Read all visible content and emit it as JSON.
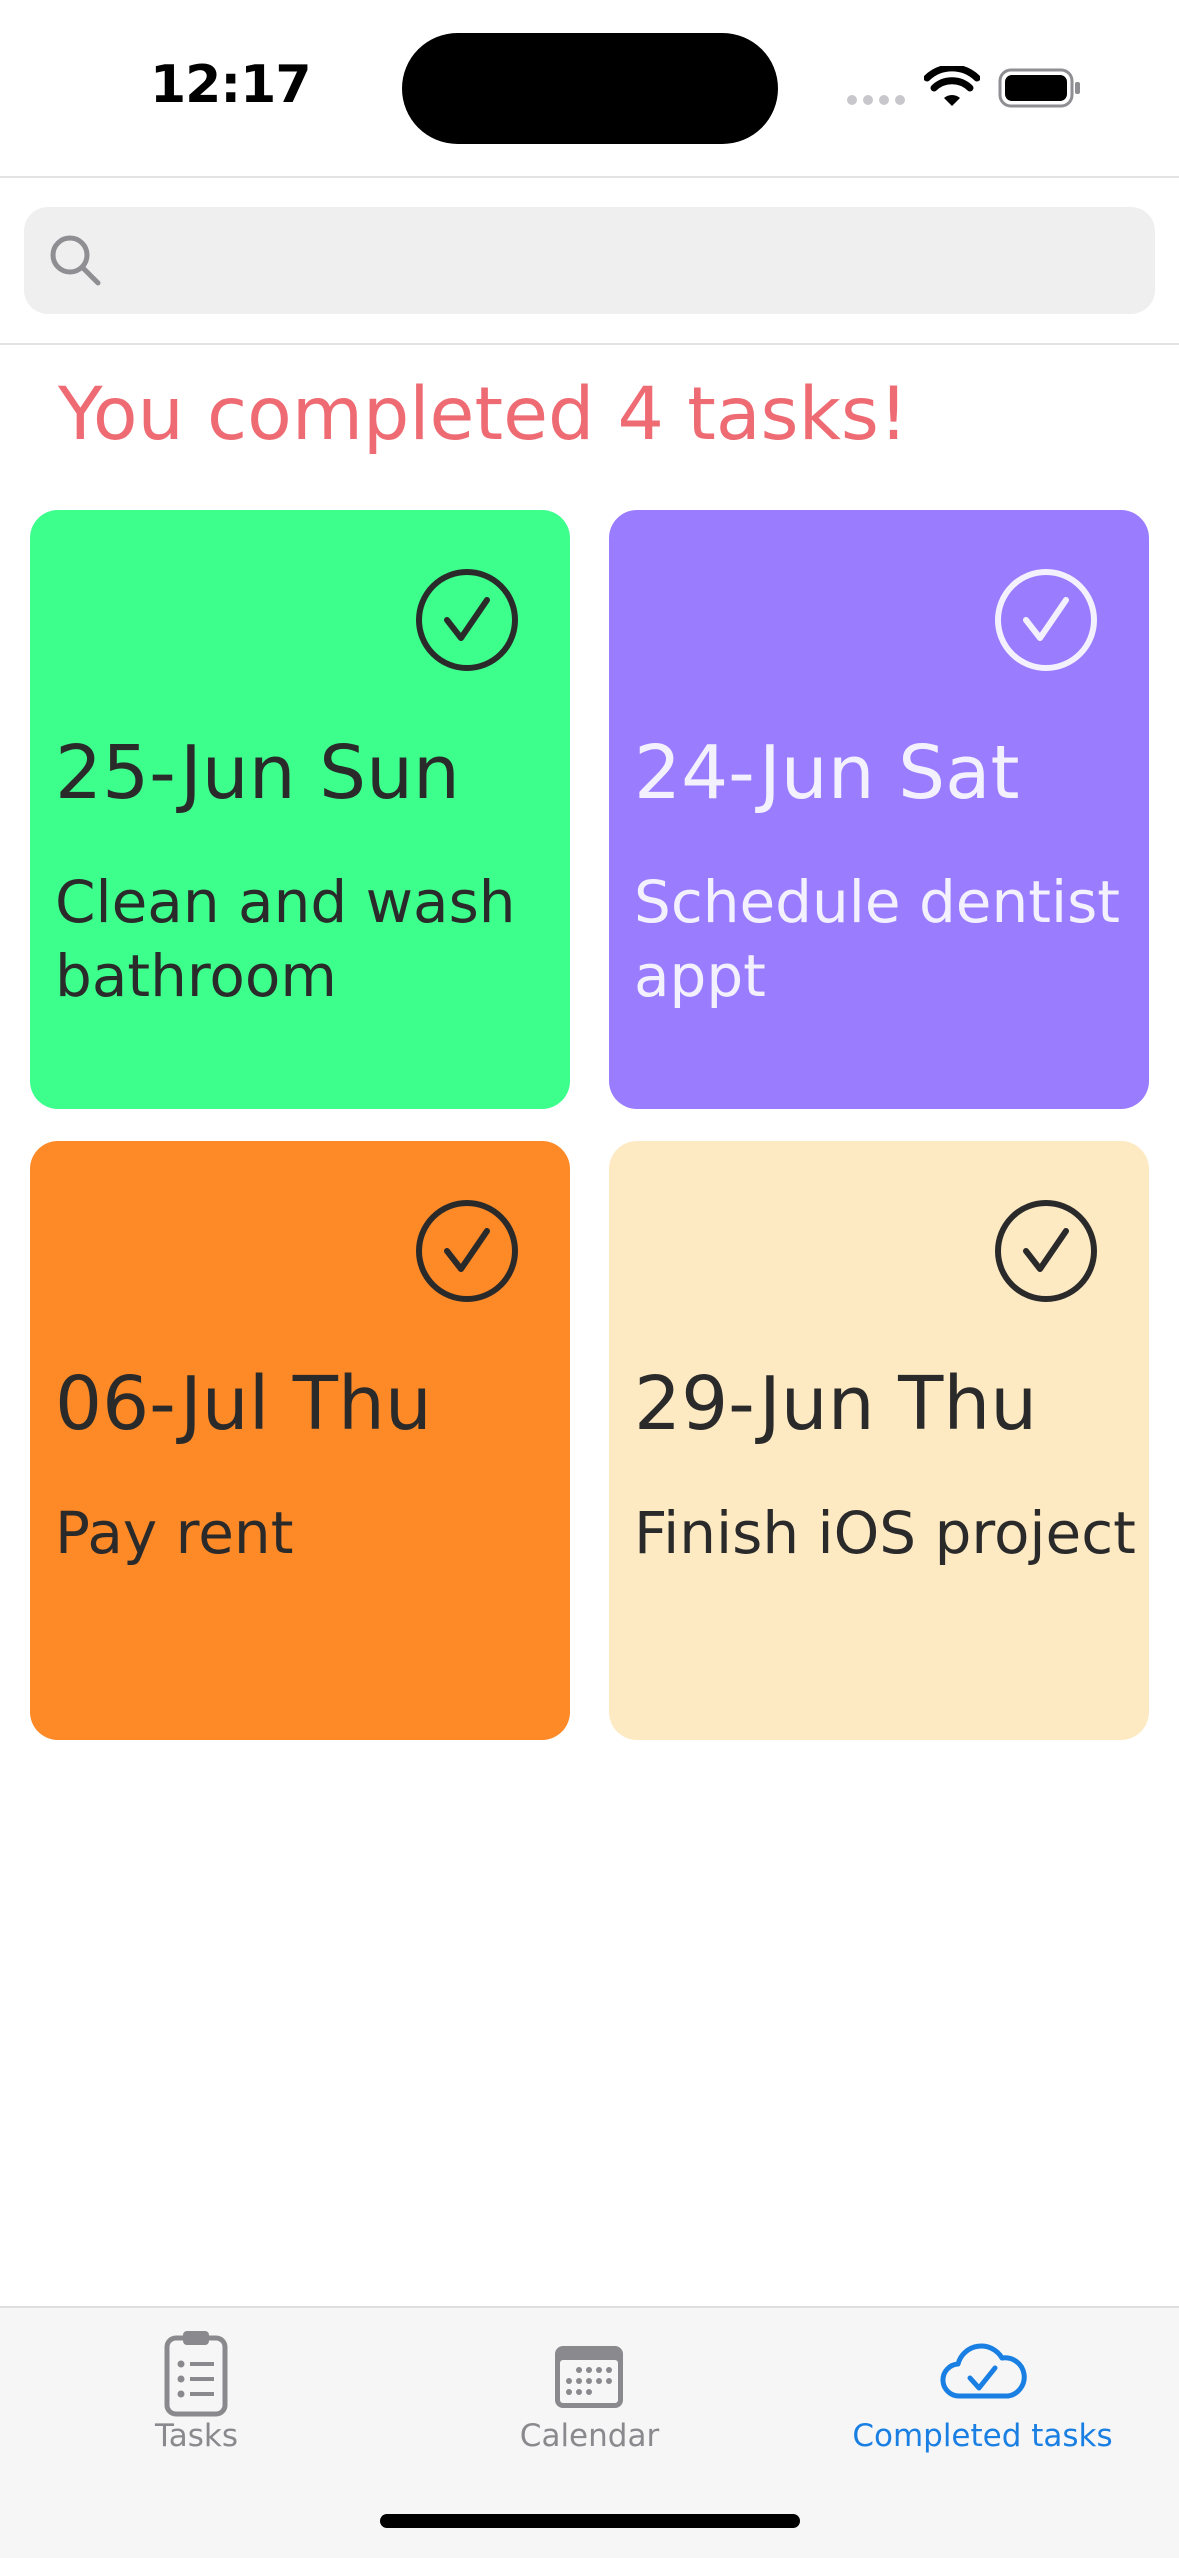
{
  "status_bar": {
    "time": "12:17"
  },
  "search": {
    "placeholder": "",
    "value": ""
  },
  "headline": "You completed 4 tasks!",
  "cards": [
    {
      "date": "25-Jun Sun",
      "description": "Clean and wash bathroom",
      "color": "#3dff8c",
      "text_color": "#2a2a2a",
      "check_color": "#2a2a2a"
    },
    {
      "date": "24-Jun Sat",
      "description": "Schedule dentist appt",
      "color": "#9a7cff",
      "text_color": "#f4f1ff",
      "check_color": "#f4f1ff"
    },
    {
      "date": "06-Jul Thu",
      "description": "Pay rent",
      "color": "#fd8927",
      "text_color": "#2a2a2a",
      "check_color": "#2a2a2a"
    },
    {
      "date": "29-Jun Thu",
      "description": "Finish iOS project",
      "color": "#fdeac3",
      "text_color": "#2a2a2a",
      "check_color": "#2a2a2a"
    }
  ],
  "tabs": [
    {
      "label": "Tasks",
      "icon": "clipboard-icon",
      "active": false
    },
    {
      "label": "Calendar",
      "icon": "calendar-icon",
      "active": false
    },
    {
      "label": "Completed tasks",
      "icon": "cloud-check-icon",
      "active": true
    }
  ],
  "colors": {
    "accent": "#1a7fe3",
    "headline": "#ee6b73",
    "inactive_tab": "#8a8a8e"
  }
}
